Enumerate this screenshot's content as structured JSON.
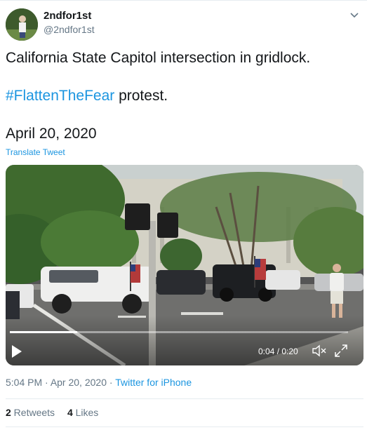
{
  "user": {
    "display_name": "2ndfor1st",
    "handle": "@2ndfor1st"
  },
  "tweet": {
    "line1": "California State Capitol intersection in gridlock.",
    "hashtag": "#FlattenTheFear",
    "line2_rest": " protest.",
    "date_line": "April 20, 2020",
    "translate_label": "Translate Tweet"
  },
  "video": {
    "time": "0:04 / 0:20",
    "progress": 0.2
  },
  "meta": {
    "time": "5:04 PM",
    "separator": " · ",
    "date": "Apr 20, 2020",
    "separator2": " · ",
    "source": "Twitter for iPhone"
  },
  "stats": {
    "retweets_count": "2",
    "retweets_label": " Retweets",
    "likes_count": "4",
    "likes_label": " Likes"
  },
  "icons": {
    "menu": "chevron-down-icon",
    "play": "play-icon",
    "mute": "mute-icon",
    "fullscreen": "expand-icon"
  },
  "colors": {
    "link": "#1b95e0",
    "secondary": "#657786",
    "text": "#14171a"
  }
}
